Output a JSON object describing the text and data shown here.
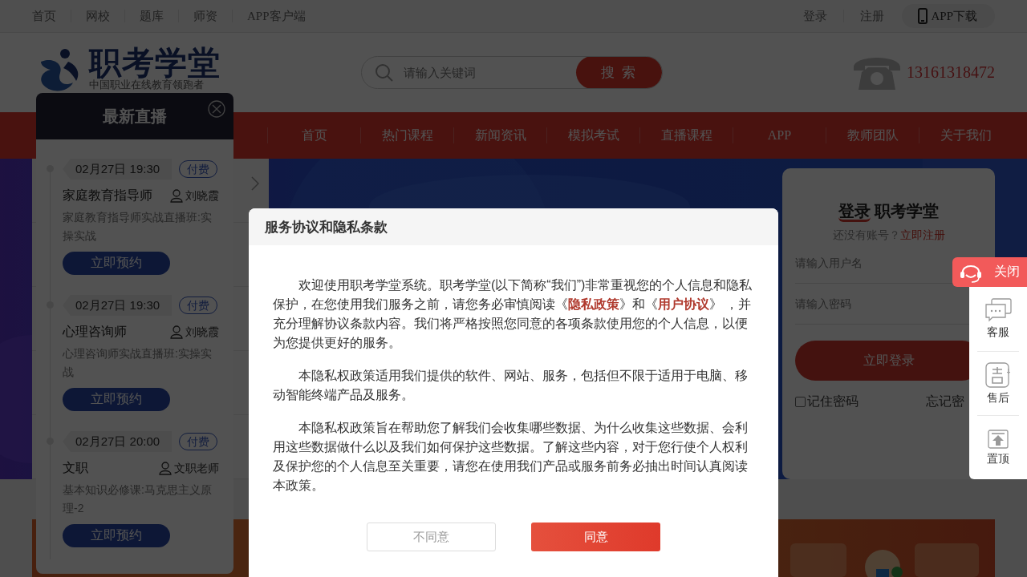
{
  "top_bar": {
    "left_links": [
      "首页",
      "网校",
      "题库",
      "师资",
      "APP客户端"
    ],
    "right_links": [
      "登录",
      "注册"
    ],
    "app_download": "APP下载"
  },
  "header": {
    "logo_name": "职考学堂",
    "logo_tagline": "中国职业在线教育领跑者",
    "search": {
      "placeholder": "请输入关键词",
      "button": "搜 索"
    },
    "phone": "13161318472"
  },
  "nav": [
    "首页",
    "热门课程",
    "新闻资讯",
    "模拟考试",
    "直播课程",
    "APP",
    "教师团队",
    "关于我们"
  ],
  "login_card": {
    "title_highlight": "登录",
    "title_rest": "职考学堂",
    "signup_prompt": "还没有账号？",
    "signup_link": "立即注册",
    "username_placeholder": "请输入用户名",
    "password_placeholder": "请输入密码",
    "submit": "立即登录",
    "remember": {
      "label": "记住密码",
      "checked": false
    },
    "forgot": "忘记密"
  },
  "live_panel": {
    "title": "最新直播",
    "items": [
      {
        "time": "02月27日 19:30",
        "badge": "付费",
        "course": "家庭教育指导师",
        "teacher": "刘晓霞",
        "description": "家庭教育指导师实战直播班:实操实战",
        "button": "立即预约"
      },
      {
        "time": "02月27日 19:30",
        "badge": "付费",
        "course": "心理咨询师",
        "teacher": "刘晓霞",
        "description": "心理咨询师实战直播班:实操实战",
        "button": "立即预约"
      },
      {
        "time": "02月27日 20:00",
        "badge": "付费",
        "course": "文职",
        "teacher": "文职老师",
        "description": "基本知识必修课:马克思主义原理-2",
        "button": "立即预约"
      }
    ]
  },
  "privacy_dialog": {
    "title": "服务协议和隐私条款",
    "paragraphs": [
      [
        {
          "kind": "text",
          "text": "欢迎使用职考学堂系统。职考学堂(以下简称“我们”)非常重视您的个人信息和隐私保护，在您使用我们服务之前，请您务必审慎阅读《"
        },
        {
          "kind": "link",
          "text": "隐私政策"
        },
        {
          "kind": "text",
          "text": "》和《"
        },
        {
          "kind": "link",
          "text": "用户协议"
        },
        {
          "kind": "text",
          "text": "》 ，并充分理解协议条款内容。我们将严格按照您同意的各项条款使用您的个人信息，以便为您提供更好的服务。"
        }
      ],
      [
        {
          "kind": "text",
          "text": "本隐私权政策适用我们提供的软件、网站、服务，包括但不限于适用于电脑、移动智能终端产品及服务。"
        }
      ],
      [
        {
          "kind": "text",
          "text": "本隐私权政策旨在帮助您了解我们会收集哪些数据、为什么收集这些数据、会利用这些数据做什么以及我们如何保护这些数据。了解这些内容，对于您行使个人权利及保护您的个人信息至关重要，请您在使用我们产品或服务前务必抽出时间认真阅读本政策。"
        }
      ]
    ],
    "buttons": [
      {
        "label": "不同意",
        "kind": "secondary"
      },
      {
        "label": "同意",
        "kind": "primary"
      }
    ]
  },
  "side_float": {
    "close": "关闭",
    "items": [
      {
        "label": "客服",
        "kind": "chat"
      },
      {
        "label": "售后",
        "kind": "aftersale"
      },
      {
        "label": "置顶",
        "kind": "top"
      }
    ]
  }
}
